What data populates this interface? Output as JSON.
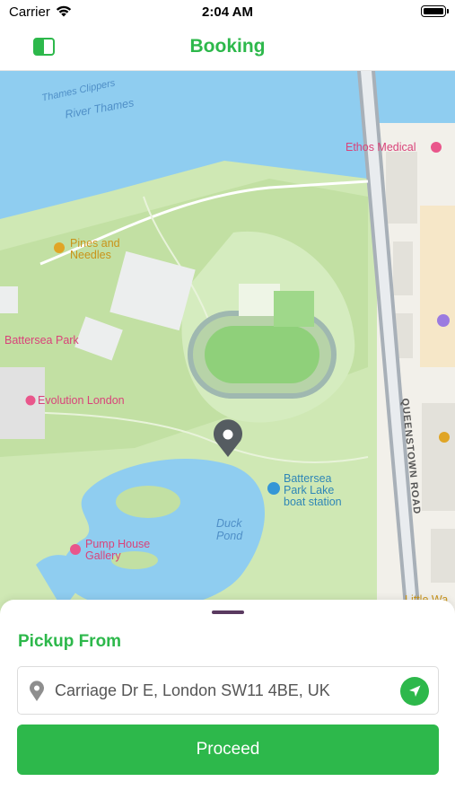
{
  "status_bar": {
    "carrier": "Carrier",
    "time": "2:04 AM"
  },
  "nav": {
    "title": "Booking",
    "menu_icon": "sidebar-toggle-icon"
  },
  "map": {
    "labels": {
      "thames_clippers": "Thames Clippers",
      "river_thames": "River Thames",
      "ethos_medical": "Ethos Medical",
      "pines_needles_1": "Pines and",
      "pines_needles_2": "Needles",
      "battersea_park": "Battersea Park",
      "evolution_london": "Evolution London",
      "boat_station_1": "Battersea",
      "boat_station_2": "Park Lake",
      "boat_station_3": "boat station",
      "duck_pond_1": "Duck",
      "duck_pond_2": "Pond",
      "pump_house_1": "Pump House",
      "pump_house_2": "Gallery",
      "queenstown_road": "QUEENSTOWN ROAD",
      "little_wa": "Little Wa"
    }
  },
  "sheet": {
    "pickup_label": "Pickup From",
    "address_value": "Carriage Dr E, London SW11 4BE, UK",
    "proceed_label": "Proceed"
  },
  "colors": {
    "accent": "#2db84b",
    "park": "#cfe8b4",
    "water": "#8fcdf0"
  }
}
